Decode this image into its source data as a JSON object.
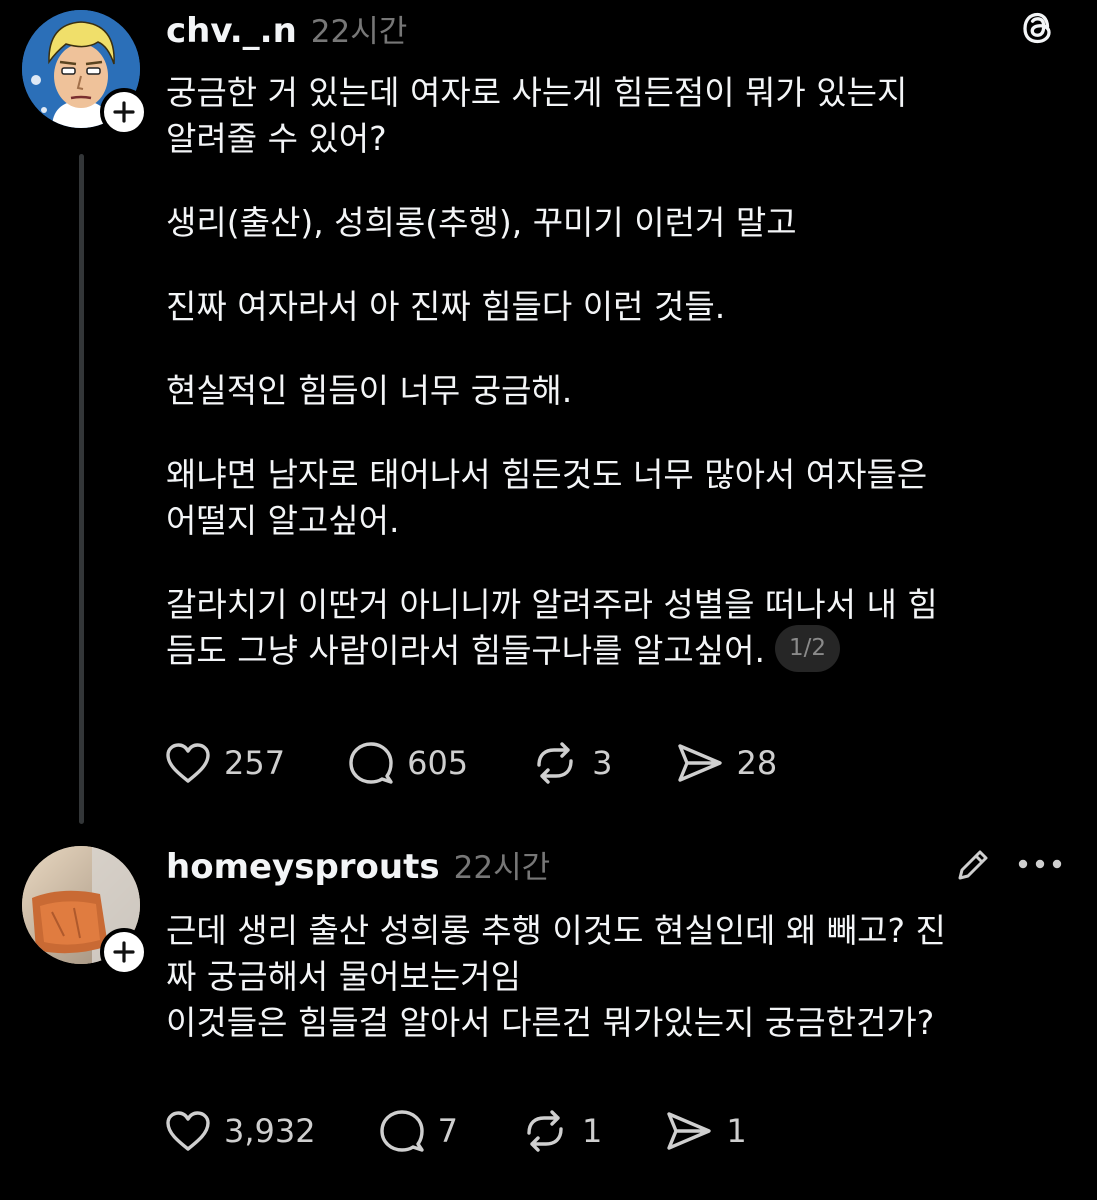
{
  "colors": {
    "background": "#000000",
    "text": "#f3f5f7",
    "muted": "#777777",
    "thread_line": "#333638"
  },
  "icons": {
    "app": "threads-logo-icon",
    "like": "heart-icon",
    "reply": "speech-bubble-icon",
    "repost": "repost-icon",
    "share": "send-icon",
    "follow": "plus-icon",
    "edit": "pencil-icon",
    "more": "more-icon"
  },
  "post1": {
    "username": "chv._.n",
    "time": "22시간",
    "paragraphs": [
      [
        "궁금한 거 있는데 여자로 사는게 힘든점이 뭐가 있는지",
        "알려줄 수 있어?"
      ],
      [
        "생리(출산), 성희롱(추행), 꾸미기 이런거 말고"
      ],
      [
        "진짜 여자라서 아 진짜 힘들다 이런 것들."
      ],
      [
        "현실적인 힘듬이 너무 궁금해."
      ],
      [
        "왜냐면 남자로 태어나서 힘든것도 너무 많아서 여자들은",
        "어떨지 알고싶어."
      ],
      [
        "갈라치기 이딴거 아니니까 알려주라 성별을 떠나서 내 힘",
        "듬도 그냥 사람이라서 힘들구나를 알고싶어."
      ]
    ],
    "page_indicator": "1/2",
    "likes": "257",
    "replies": "605",
    "reposts": "3",
    "shares": "28"
  },
  "post2": {
    "username": "homeysprouts",
    "time": "22시간",
    "lines": [
      "근데 생리 출산 성희롱 추행 이것도 현실인데 왜 빼고? 진",
      "짜 궁금해서 물어보는거임",
      "이것들은 힘들걸 알아서 다른건 뭐가있는지 궁금한건가?"
    ],
    "likes": "3,932",
    "replies": "7",
    "reposts": "1",
    "shares": "1"
  }
}
